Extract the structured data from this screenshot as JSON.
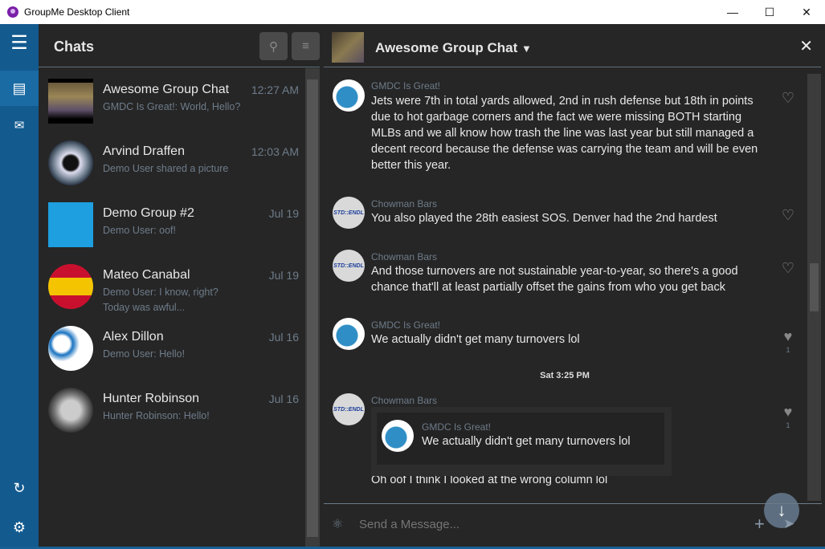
{
  "window": {
    "title": "GroupMe Desktop Client",
    "minimize": "—",
    "maximize": "☐",
    "close": "✕"
  },
  "rail": {
    "menu_icon": "hamburger-icon",
    "chats_icon": "chat-bubble-icon",
    "contacts_icon": "mail-search-icon",
    "refresh_icon": "refresh-icon",
    "settings_icon": "gear-icon"
  },
  "list": {
    "title": "Chats",
    "chats": [
      {
        "name": "Awesome Group Chat",
        "time": "12:27 AM",
        "preview": "GMDC Is Great!: World, Hello?"
      },
      {
        "name": "Arvind Draffen",
        "time": "12:03 AM",
        "preview": "Demo User shared a picture"
      },
      {
        "name": "Demo Group #2",
        "time": "Jul 19",
        "preview": "Demo User: oof!"
      },
      {
        "name": "Mateo Canabal",
        "time": "Jul 19",
        "preview": "Demo User: I know, right? Today was awful..."
      },
      {
        "name": "Alex Dillon",
        "time": "Jul 16",
        "preview": "Demo User: Hello!"
      },
      {
        "name": "Hunter Robinson",
        "time": "Jul 16",
        "preview": "Hunter Robinson: Hello!"
      }
    ]
  },
  "chat": {
    "title": "Awesome Group Chat",
    "dropdown": "▼",
    "close": "✕",
    "messages": [
      {
        "sender": "GMDC Is Great!",
        "text": "Jets were 7th in total yards allowed, 2nd in rush defense but 18th in points due to hot garbage corners and the fact we were missing BOTH starting MLBs and we all know how trash the line was last year but still managed a decent record because the defense was carrying the team and will be even better this year.",
        "likes": ""
      },
      {
        "sender": "Chowman Bars",
        "text": "You also played the 28th easiest SOS. Denver had the 2nd hardest",
        "likes": ""
      },
      {
        "sender": "Chowman Bars",
        "text": "And those turnovers are not sustainable year-to-year, so there's a good chance that'll at least partially offset the gains from who you get back",
        "likes": ""
      },
      {
        "sender": "GMDC Is Great!",
        "text": "We actually didn't get many turnovers lol",
        "likes": "1"
      },
      {
        "sender": "Chowman Bars",
        "text": "Oh oof I think I looked at the wrong column lol",
        "likes": "1",
        "quote": {
          "sender": "GMDC Is Great!",
          "text": "We actually didn't get many turnovers lol"
        }
      }
    ],
    "timestamp": "Sat 3:25 PM",
    "avatar_label": "STD::ENDL",
    "input_placeholder": "Send a Message..."
  }
}
